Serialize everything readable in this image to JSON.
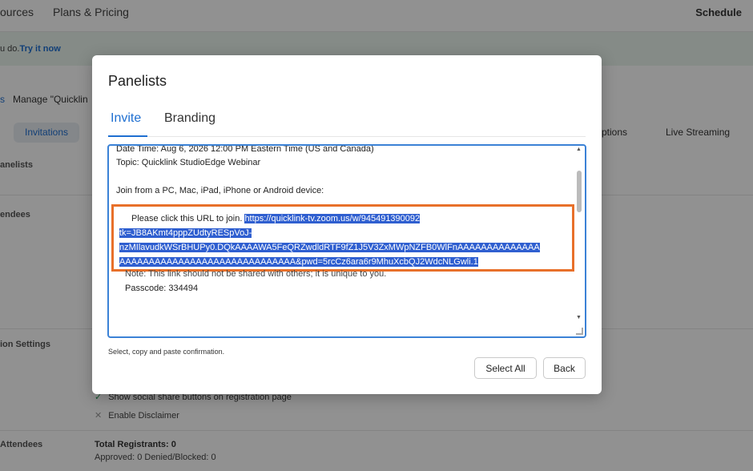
{
  "nav": {
    "item1": "ources",
    "item2": "Plans & Pricing",
    "schedule": "Schedule"
  },
  "banner": {
    "text": "u do.",
    "link": "Try it now"
  },
  "breadcrumb": {
    "arrow": "s",
    "current": "Manage \"Quicklin"
  },
  "page_tabs": {
    "invitations": "Invitations",
    "options": "ptions",
    "live_streaming": "Live Streaming"
  },
  "sections": {
    "panelists": "anelists",
    "attendees": "endees",
    "option_settings": "ion Settings",
    "attendees2": "Attendees"
  },
  "settings": {
    "social_share": "Show social share buttons on registration page",
    "disclaimer": "Enable Disclaimer"
  },
  "registrants": {
    "total": "Total Registrants: 0",
    "approved": "Approved: 0   Denied/Blocked: 0"
  },
  "modal": {
    "title": "Panelists",
    "tabs": {
      "invite": "Invite",
      "branding": "Branding"
    },
    "content": {
      "date_time": "Date Time: Aug 6, 2026 12:00 PM Eastern Time (US and Canada)",
      "topic": "Topic: Quicklink StudioEdge Webinar",
      "join_from": "Join from a PC, Mac, iPad, iPhone or Android device:",
      "url_intro": "Please click this URL to join.",
      "url_line1": "https://quicklink-tv.zoom.us/w/945491390092",
      "url_line2": "tk=JB8AKmt4pppZUdtyRESpVoJ-",
      "url_line3": "nzMIlavudkWSrBHUPy0.DQkAAAAWA5FeQRZwdldRTF9fZ1J5V3ZxMWpNZFB0WlFnAAAAAAAAAAAAAA",
      "url_line4": "AAAAAAAAAAAAAAAAAAAAAAAAAAAAAA&pwd=5rcCz6ara6r9MhuXcbQJ2WdcNLGwli.1",
      "note": "Note: This link should not be shared with others; it is unique to you.",
      "passcode": "Passcode: 334494"
    },
    "hint": "Select, copy and paste confirmation.",
    "buttons": {
      "select_all": "Select All",
      "back": "Back"
    }
  },
  "colors": {
    "accent": "#1f6fd1",
    "highlight_border": "#e8702a",
    "selection": "#2f5fd0"
  }
}
